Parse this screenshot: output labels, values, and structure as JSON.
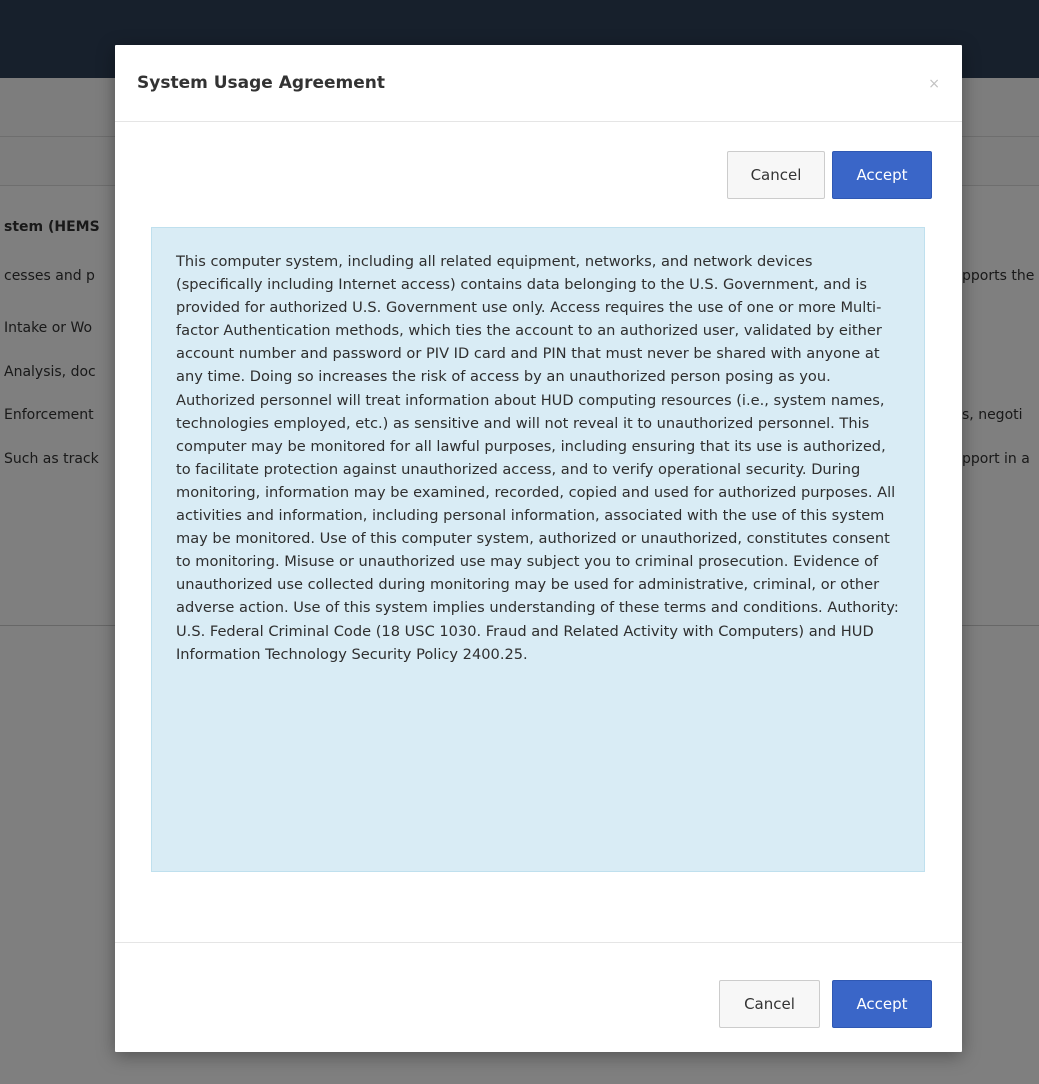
{
  "background": {
    "heading_fragment": "stem (HEMS",
    "left_lines": [
      "cesses and p",
      "Intake or Wo",
      "Analysis, doc",
      "Enforcement",
      "Such as track"
    ],
    "right_lines": [
      "pports the",
      "s, negoti",
      "pport in a"
    ]
  },
  "modal": {
    "title": "System Usage Agreement",
    "close_glyph": "×",
    "top_actions": {
      "cancel_label": "Cancel",
      "accept_label": "Accept"
    },
    "notice": "This computer system, including all related equipment, networks, and network devices (specifically including Internet access) contains data belonging to the U.S. Government, and is provided for authorized U.S. Government use only. Access requires the use of one or more Multi-factor Authentication methods, which ties the account to an authorized user, validated by either account number and password or PIV ID card and PIN that must never be shared with anyone at any time. Doing so increases the risk of access by an unauthorized person posing as you. Authorized personnel will treat information about HUD computing resources (i.e., system names, technologies employed, etc.) as sensitive and will not reveal it to unauthorized personnel. This computer may be monitored for all lawful purposes, including ensuring that its use is authorized, to facilitate protection against unauthorized access, and to verify operational security. During monitoring, information may be examined, recorded, copied and used for authorized purposes. All activities and information, including personal information, associated with the use of this system may be monitored. Use of this computer system, authorized or unauthorized, constitutes consent to monitoring. Misuse or unauthorized use may subject you to criminal prosecution. Evidence of unauthorized use collected during monitoring may be used for administrative, criminal, or other adverse action. Use of this system implies understanding of these terms and conditions. Authority: U.S. Federal Criminal Code (18 USC 1030. Fraud and Related Activity with Computers) and HUD Information Technology Security Policy 2400.25.",
    "bottom_actions": {
      "cancel_label": "Cancel",
      "accept_label": "Accept"
    }
  },
  "colors": {
    "topbar": "#2e4158",
    "accept_button": "#3a66c8",
    "notice_background": "#d9ecf5",
    "notice_border": "#bfe0ee"
  }
}
